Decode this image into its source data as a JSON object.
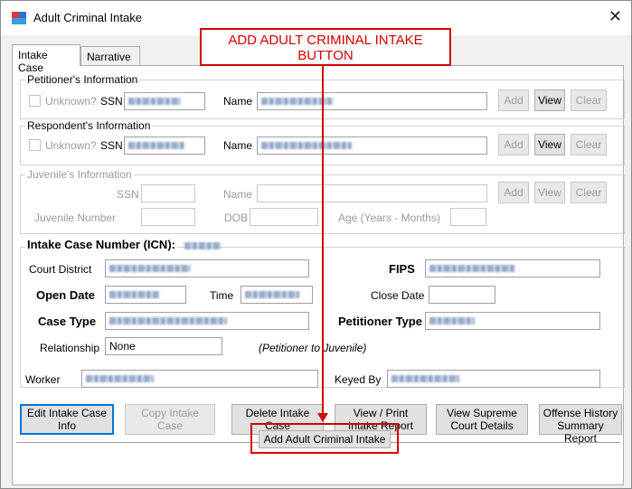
{
  "window": {
    "title": "Adult Criminal Intake",
    "close_glyph": "✕"
  },
  "tabs": [
    {
      "label": "Intake Case",
      "active": true
    },
    {
      "label": "Narrative",
      "active": false
    }
  ],
  "callout": {
    "text": "ADD ADULT CRIMINAL INTAKE\nBUTTON",
    "color": "#d40000"
  },
  "petitioner": {
    "group_title": "Petitioner's Information",
    "unknown_label": "Unknown?",
    "ssn_label": "SSN",
    "name_label": "Name",
    "add": "Add",
    "view": "View",
    "clear": "Clear"
  },
  "respondent": {
    "group_title": "Respondent's Information",
    "unknown_label": "Unknown?",
    "ssn_label": "SSN",
    "name_label": "Name",
    "add": "Add",
    "view": "View",
    "clear": "Clear"
  },
  "juvenile": {
    "group_title": "Juvenile's Information",
    "ssn_label": "SSN",
    "name_label": "Name",
    "juvenile_number_label": "Juvenile Number",
    "dob_label": "DOB",
    "age_label": "Age (Years - Months)",
    "add": "Add",
    "view": "View",
    "clear": "Clear"
  },
  "intake": {
    "icn_label": "Intake Case Number (ICN):",
    "court_district_label": "Court District",
    "fips_label": "FIPS",
    "open_date_label": "Open Date",
    "time_label": "Time",
    "close_date_label": "Close Date",
    "case_type_label": "Case Type",
    "petitioner_type_label": "Petitioner Type",
    "relationship_label": "Relationship",
    "relationship_value": "None",
    "relationship_note": "(Petitioner to Juvenile)",
    "worker_label": "Worker",
    "keyed_by_label": "Keyed By"
  },
  "actions": {
    "edit": "Edit Intake Case\nInfo",
    "copy": "Copy Intake\nCase",
    "delete": "Delete Intake\nCase",
    "view_print": "View / Print\nIntake Report",
    "supreme": "View Supreme\nCourt Details",
    "offense": "Offense History\nSummary Report",
    "add_adult": "Add Adult Criminal Intake"
  }
}
